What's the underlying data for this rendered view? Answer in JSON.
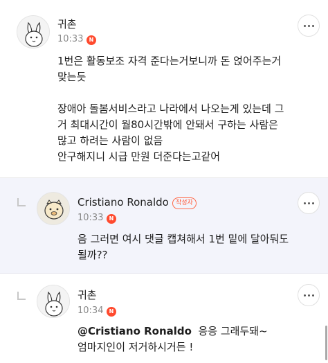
{
  "comments": [
    {
      "author": "귀촌",
      "time": "10:33",
      "new_badge": "N",
      "lines": [
        "1번은 활동보조 자격 준다는거보니까 돈 얹어주는거",
        "맞는듯",
        "장애아 돌봄서비스라고 나라에서 나오는게 있는데 그",
        "거 최대시간이 월80시간밖에 안돼서 구하는 사람은",
        "많고 하려는 사람이 없음",
        "안구해지니 시급 만원 더준다는고같어"
      ]
    },
    {
      "author": "Cristiano Ronaldo",
      "author_badge": "작성자",
      "time": "10:33",
      "new_badge": "N",
      "lines": [
        "음 그러면 여시 댓글 캡쳐해서 1번 밑에 달아둬도",
        "될까??"
      ]
    },
    {
      "author": "귀촌",
      "time": "10:34",
      "new_badge": "N",
      "mention": "@Cristiano Ronaldo",
      "first_line_rest": "  응응 그래두돼~",
      "lines": [
        "엄마지인이 저거하시거든 !"
      ]
    }
  ],
  "icons": {
    "avatar": "bunny-avatar-icon",
    "more": "more-dots-icon",
    "reply": "reply-arrow-icon"
  },
  "colors": {
    "reply_background": "#f3f4fb",
    "new_badge": "#ff4a2e",
    "author_badge": "#ff5a3a"
  }
}
